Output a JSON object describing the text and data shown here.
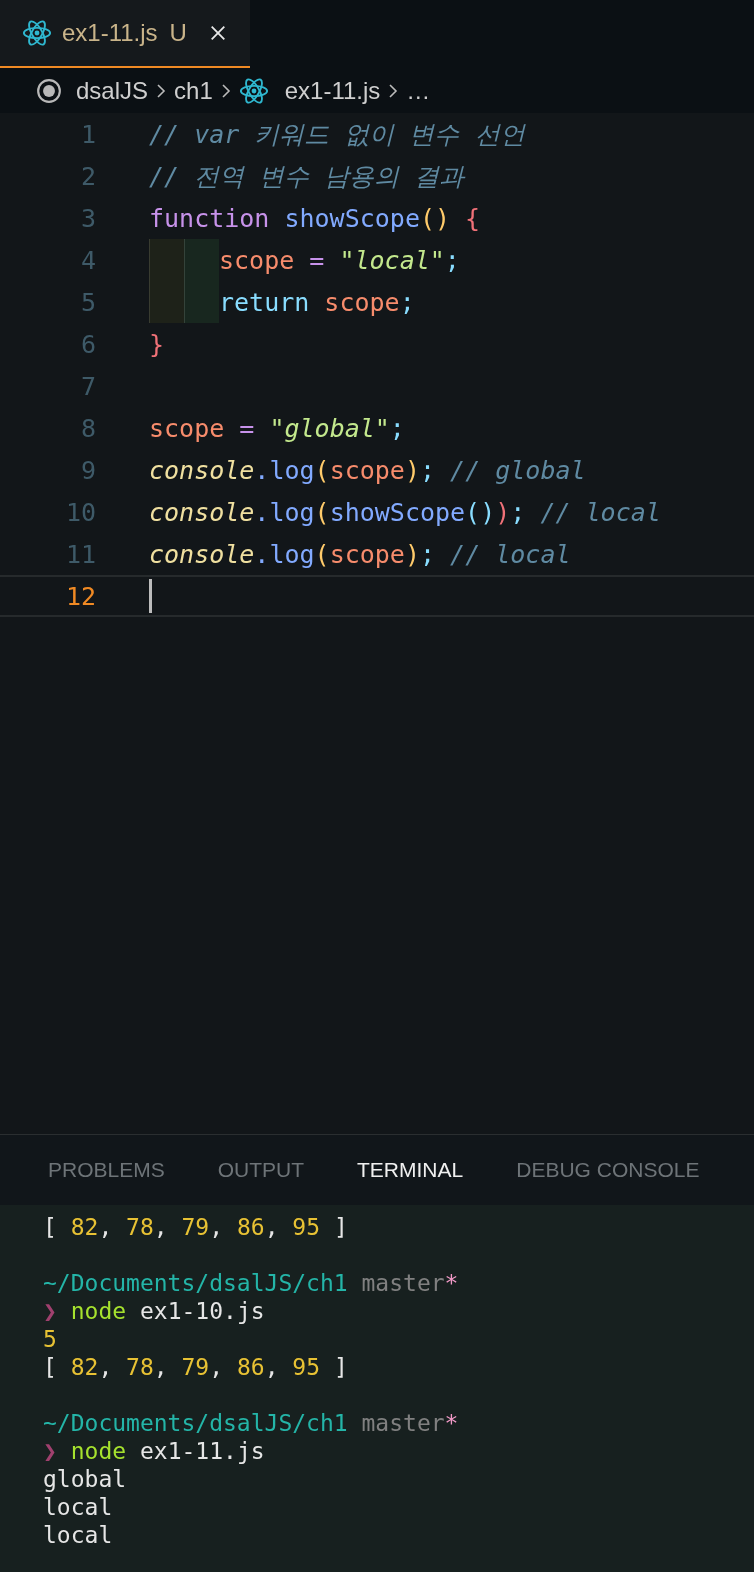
{
  "tabs": [
    {
      "label": "ex1-11.js",
      "status": "U",
      "selected": true
    }
  ],
  "breadcrumb": [
    {
      "kind": "folder",
      "label": "dsalJS"
    },
    {
      "kind": "folder",
      "label": "ch1"
    },
    {
      "kind": "file",
      "label": "ex1-11.js"
    },
    {
      "kind": "more",
      "label": "…"
    }
  ],
  "code_lines": [
    {
      "number": "1",
      "current": false,
      "tokens": [
        {
          "kind": "comment",
          "text": "// var 키워드 없이 변수 선언"
        }
      ]
    },
    {
      "number": "2",
      "current": false,
      "tokens": [
        {
          "kind": "comment",
          "text": "// 전역 변수 남용의 결과"
        }
      ]
    },
    {
      "number": "3",
      "current": false,
      "tokens": [
        {
          "kind": "keyword",
          "text": "function "
        },
        {
          "kind": "func",
          "text": "showScope"
        },
        {
          "kind": "paren",
          "text": "() "
        },
        {
          "kind": "brace",
          "text": "{"
        }
      ]
    },
    {
      "number": "4",
      "current": false,
      "indented": true,
      "tokens": [
        {
          "kind": "var",
          "text": "scope "
        },
        {
          "kind": "operator",
          "text": "= "
        },
        {
          "kind": "string",
          "text": "\"local\""
        },
        {
          "kind": "punct",
          "text": ";"
        }
      ]
    },
    {
      "number": "5",
      "current": false,
      "indented": true,
      "tokens": [
        {
          "kind": "punct",
          "text": "return "
        },
        {
          "kind": "var",
          "text": "scope"
        },
        {
          "kind": "punct",
          "text": ";"
        }
      ]
    },
    {
      "number": "6",
      "current": false,
      "tokens": [
        {
          "kind": "brace",
          "text": "}"
        }
      ]
    },
    {
      "number": "7",
      "current": false
    },
    {
      "number": "8",
      "current": false,
      "tokens": [
        {
          "kind": "var",
          "text": "scope "
        },
        {
          "kind": "operator",
          "text": "= "
        },
        {
          "kind": "string",
          "text": "\"global\""
        },
        {
          "kind": "punct",
          "text": ";"
        }
      ]
    },
    {
      "number": "9",
      "current": false,
      "tokens": [
        {
          "kind": "object",
          "text": "console"
        },
        {
          "kind": "func",
          "text": ".log"
        },
        {
          "kind": "paren",
          "text": "("
        },
        {
          "kind": "var",
          "text": "scope"
        },
        {
          "kind": "paren",
          "text": ")"
        },
        {
          "kind": "punct",
          "text": "; "
        },
        {
          "kind": "comment",
          "text": "// global"
        }
      ]
    },
    {
      "number": "10",
      "current": false,
      "tokens": [
        {
          "kind": "object",
          "text": "console"
        },
        {
          "kind": "func",
          "text": ".log"
        },
        {
          "kind": "paren",
          "text": "("
        },
        {
          "kind": "func",
          "text": "showScope"
        },
        {
          "kind": "punct",
          "text": "()"
        },
        {
          "kind": "brace",
          "text": ")"
        },
        {
          "kind": "punct",
          "text": "; "
        },
        {
          "kind": "comment",
          "text": "// local"
        }
      ]
    },
    {
      "number": "11",
      "current": false,
      "tokens": [
        {
          "kind": "object",
          "text": "console"
        },
        {
          "kind": "func",
          "text": ".log"
        },
        {
          "kind": "paren",
          "text": "("
        },
        {
          "kind": "var",
          "text": "scope"
        },
        {
          "kind": "paren",
          "text": ")"
        },
        {
          "kind": "punct",
          "text": "; "
        },
        {
          "kind": "comment",
          "text": "// local"
        }
      ]
    },
    {
      "number": "12",
      "current": true
    }
  ],
  "panel_tabs": [
    {
      "label": "PROBLEMS",
      "selected": false
    },
    {
      "label": "OUTPUT",
      "selected": false
    },
    {
      "label": "TERMINAL",
      "selected": true
    },
    {
      "label": "DEBUG CONSOLE",
      "selected": false
    }
  ],
  "terminal_lines": [
    {
      "kind": "text",
      "tokens": [
        {
          "kind": "plain",
          "text": "[ "
        },
        {
          "kind": "number",
          "text": "82"
        },
        {
          "kind": "plain",
          "text": ", "
        },
        {
          "kind": "number",
          "text": "78"
        },
        {
          "kind": "plain",
          "text": ", "
        },
        {
          "kind": "number",
          "text": "79"
        },
        {
          "kind": "plain",
          "text": ", "
        },
        {
          "kind": "number",
          "text": "86"
        },
        {
          "kind": "plain",
          "text": ", "
        },
        {
          "kind": "number",
          "text": "95"
        },
        {
          "kind": "plain",
          "text": " ]"
        }
      ]
    },
    {
      "kind": "blank"
    },
    {
      "kind": "text",
      "tokens": [
        {
          "kind": "path",
          "text": "~/Documents/dsalJS/ch1 "
        },
        {
          "kind": "branch",
          "text": "master"
        },
        {
          "kind": "dirty",
          "text": "*"
        }
      ]
    },
    {
      "kind": "text",
      "tokens": [
        {
          "kind": "prompt",
          "text": "❯ "
        },
        {
          "kind": "command",
          "text": "node "
        },
        {
          "kind": "plain",
          "text": "ex1-10.js"
        }
      ]
    },
    {
      "kind": "text",
      "tokens": [
        {
          "kind": "number",
          "text": "5"
        }
      ]
    },
    {
      "kind": "text",
      "tokens": [
        {
          "kind": "plain",
          "text": "[ "
        },
        {
          "kind": "number",
          "text": "82"
        },
        {
          "kind": "plain",
          "text": ", "
        },
        {
          "kind": "number",
          "text": "78"
        },
        {
          "kind": "plain",
          "text": ", "
        },
        {
          "kind": "number",
          "text": "79"
        },
        {
          "kind": "plain",
          "text": ", "
        },
        {
          "kind": "number",
          "text": "86"
        },
        {
          "kind": "plain",
          "text": ", "
        },
        {
          "kind": "number",
          "text": "95"
        },
        {
          "kind": "plain",
          "text": " ]"
        }
      ]
    },
    {
      "kind": "blank"
    },
    {
      "kind": "text",
      "tokens": [
        {
          "kind": "path",
          "text": "~/Documents/dsalJS/ch1 "
        },
        {
          "kind": "branch",
          "text": "master"
        },
        {
          "kind": "dirty",
          "text": "*"
        }
      ]
    },
    {
      "kind": "text",
      "tokens": [
        {
          "kind": "prompt",
          "text": "❯ "
        },
        {
          "kind": "command",
          "text": "node "
        },
        {
          "kind": "plain",
          "text": "ex1-11.js"
        }
      ]
    },
    {
      "kind": "text",
      "tokens": [
        {
          "kind": "plain",
          "text": "global"
        }
      ]
    },
    {
      "kind": "text",
      "tokens": [
        {
          "kind": "plain",
          "text": "local"
        }
      ]
    },
    {
      "kind": "text",
      "tokens": [
        {
          "kind": "plain",
          "text": "local"
        }
      ]
    }
  ]
}
